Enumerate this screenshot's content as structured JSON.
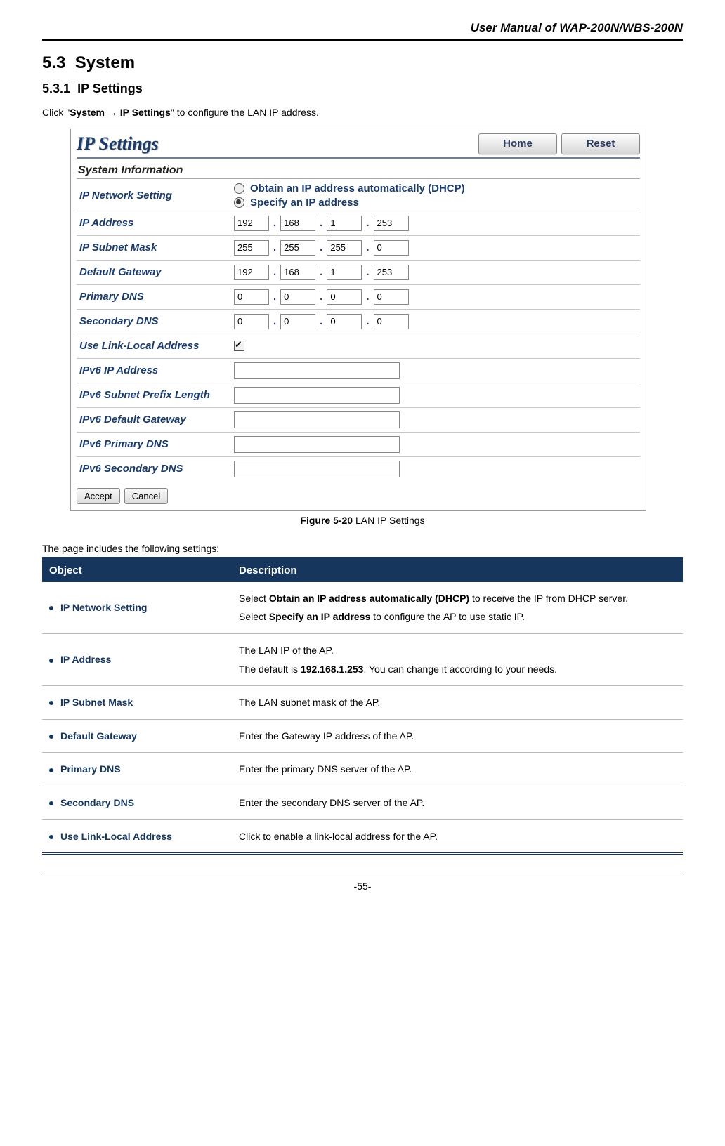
{
  "doc": {
    "header": "User Manual of WAP-200N/WBS-200N",
    "section_num": "5.3",
    "section_title": "System",
    "subsection_num": "5.3.1",
    "subsection_title": "IP Settings",
    "intro_prefix": "Click \"",
    "intro_bold": "System → IP Settings",
    "intro_suffix": "\" to configure the LAN IP address.",
    "figure_label": "Figure 5-20",
    "figure_caption": "LAN IP Settings",
    "settings_intro": "The page includes the following settings:",
    "page_number": "-55-"
  },
  "screenshot": {
    "title": "IP Settings",
    "home_btn": "Home",
    "reset_btn": "Reset",
    "section": "System Information",
    "labels": {
      "ip_net": "IP Network Setting",
      "ip_addr": "IP Address",
      "subnet": "IP Subnet Mask",
      "gateway": "Default Gateway",
      "pdns": "Primary DNS",
      "sdns": "Secondary DNS",
      "linklocal": "Use Link-Local Address",
      "v6ip": "IPv6 IP Address",
      "v6prefix": "IPv6 Subnet Prefix Length",
      "v6gw": "IPv6 Default Gateway",
      "v6pdns": "IPv6 Primary DNS",
      "v6sdns": "IPv6 Secondary DNS"
    },
    "radios": {
      "dhcp": "Obtain an IP address automatically (DHCP)",
      "static": "Specify an IP address",
      "selected": "static"
    },
    "ip_addr": [
      "192",
      "168",
      "1",
      "253"
    ],
    "subnet": [
      "255",
      "255",
      "255",
      "0"
    ],
    "gateway": [
      "192",
      "168",
      "1",
      "253"
    ],
    "pdns": [
      "0",
      "0",
      "0",
      "0"
    ],
    "sdns": [
      "0",
      "0",
      "0",
      "0"
    ],
    "linklocal_checked": true,
    "accept": "Accept",
    "cancel": "Cancel"
  },
  "table": {
    "head_obj": "Object",
    "head_desc": "Description",
    "rows": [
      {
        "obj": "IP Network Setting",
        "desc_pre": "Select ",
        "desc_b1": "Obtain an IP address automatically (DHCP)",
        "desc_mid1": " to receive the IP from DHCP server.",
        "desc_br": true,
        "desc_pre2": "Select ",
        "desc_b2": "Specify an IP address",
        "desc_mid2": " to configure the AP to use static IP."
      },
      {
        "obj": "IP Address",
        "desc_pre": "The LAN IP of the AP.",
        "desc_br": true,
        "desc_pre2": "The default is ",
        "desc_b2": "192.168.1.253",
        "desc_mid2": ". You can change it according to your needs."
      },
      {
        "obj": "IP Subnet Mask",
        "desc_pre": "The LAN subnet mask of the AP."
      },
      {
        "obj": "Default Gateway",
        "desc_pre": "Enter the Gateway IP address of the AP."
      },
      {
        "obj": "Primary DNS",
        "desc_pre": "Enter the primary DNS server of the AP."
      },
      {
        "obj": "Secondary DNS",
        "desc_pre": "Enter the secondary DNS server of the AP."
      },
      {
        "obj": "Use Link-Local Address",
        "desc_pre": "Click to enable a link-local address for the AP."
      }
    ]
  }
}
